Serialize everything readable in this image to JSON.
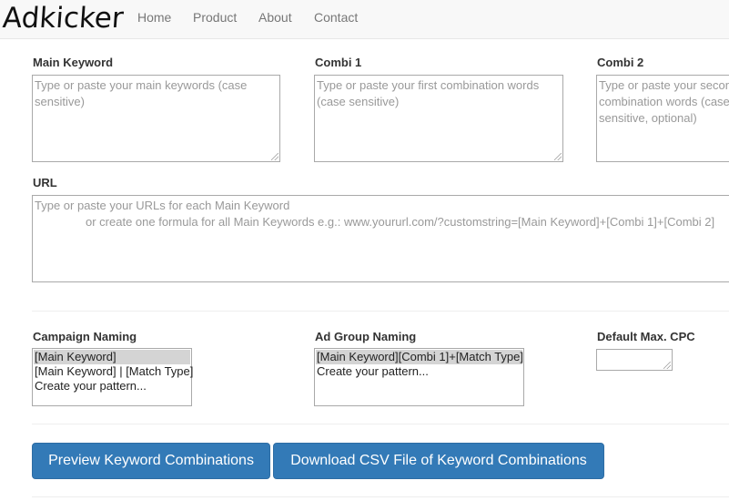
{
  "nav": {
    "logo": "Adkicker",
    "links": [
      "Home",
      "Product",
      "About",
      "Contact"
    ]
  },
  "fields": {
    "main_keyword": {
      "label": "Main Keyword",
      "placeholder": "Type or paste your main keywords (case sensitive)"
    },
    "combi1": {
      "label": "Combi 1",
      "placeholder": "Type or paste your first combination words (case sensitive)"
    },
    "combi2": {
      "label": "Combi 2",
      "placeholder": "Type or paste your second combination words (case sensitive, optional)"
    },
    "url": {
      "label": "URL",
      "placeholder_line1": "Type or paste your URLs for each Main Keyword",
      "placeholder_line2": "or create one formula for all Main Keywords e.g.: www.yoururl.com/?customstring=[Main Keyword]+[Combi 1]+[Combi 2]"
    }
  },
  "campaign_naming": {
    "label": "Campaign Naming",
    "options": [
      "[Main Keyword]",
      "[Main Keyword] | [Match Type]",
      "Create your pattern..."
    ],
    "selected": "[Main Keyword]"
  },
  "adgroup_naming": {
    "label": "Ad Group Naming",
    "options": [
      "[Main Keyword][Combi 1]+[Match Type]",
      "Create your pattern..."
    ],
    "selected": "[Main Keyword][Combi 1]+[Match Type]"
  },
  "cpc": {
    "label": "Default Max. CPC",
    "value": ""
  },
  "buttons": {
    "preview": "Preview Keyword Combinations",
    "download": "Download CSV File of Keyword Combinations"
  },
  "colors": {
    "primary": "#337ab7",
    "navbar_bg": "#f8f8f8",
    "placeholder": "#999999"
  }
}
